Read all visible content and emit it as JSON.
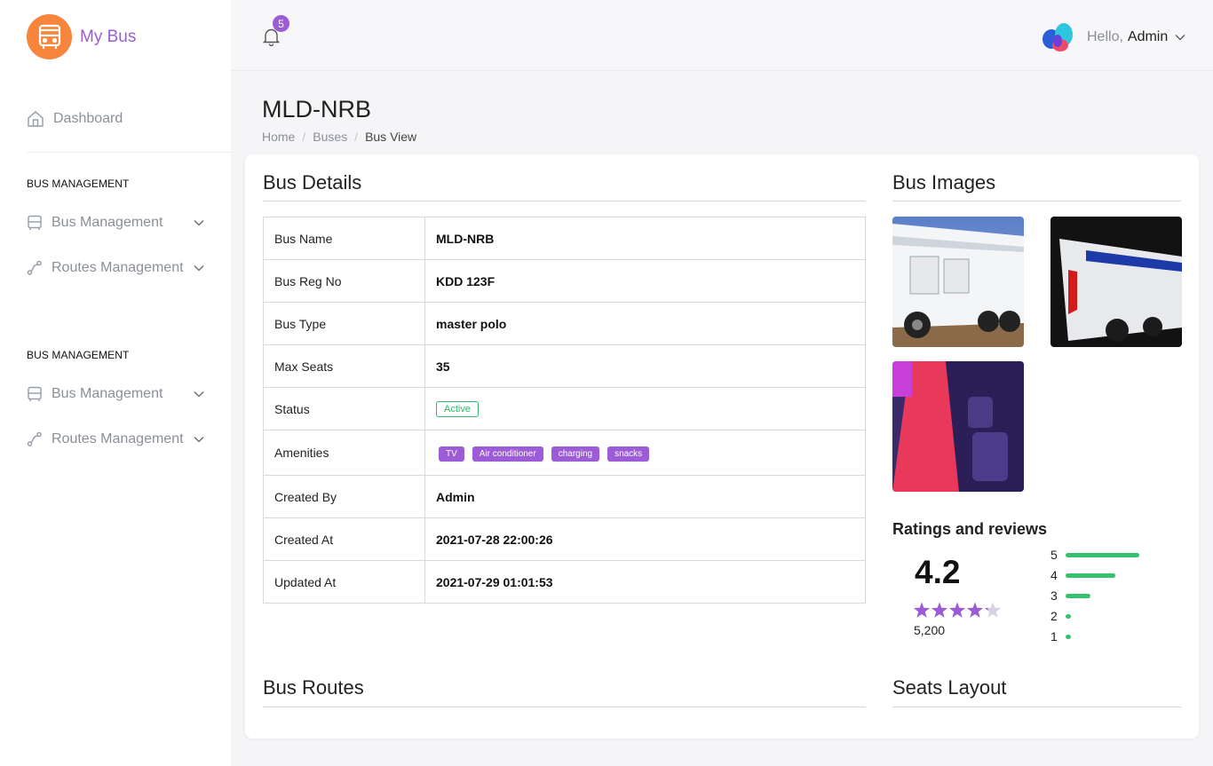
{
  "brand": {
    "name": "My Bus",
    "accent": "#9b5cd6",
    "logo_color": "#f7853b"
  },
  "sidebar": {
    "dashboard": "Dashboard",
    "sections": [
      {
        "heading": "BUS MANAGEMENT",
        "items": [
          {
            "label": "Bus Management",
            "icon": "bus-icon"
          },
          {
            "label": "Routes Management",
            "icon": "route-icon"
          }
        ]
      },
      {
        "heading": "BUS MANAGEMENT",
        "items": [
          {
            "label": "Bus Management",
            "icon": "bus-icon"
          },
          {
            "label": "Routes Management",
            "icon": "route-icon"
          }
        ]
      }
    ]
  },
  "topbar": {
    "notifications": "5",
    "greeting": "Hello,",
    "user": "Admin"
  },
  "page": {
    "title": "MLD-NRB",
    "breadcrumb": [
      "Home",
      "Buses",
      "Bus View"
    ]
  },
  "details": {
    "heading": "Bus Details",
    "rows": [
      {
        "key": "Bus Name",
        "value": "MLD-NRB"
      },
      {
        "key": "Bus Reg No",
        "value": "KDD 123F"
      },
      {
        "key": "Bus Type",
        "value": "master polo"
      },
      {
        "key": "Max Seats",
        "value": "35"
      },
      {
        "key": "Status",
        "value": "Active"
      },
      {
        "key": "Amenities",
        "tags": [
          "TV",
          "Air conditioner",
          "charging",
          "snacks"
        ]
      },
      {
        "key": "Created By",
        "value": "Admin"
      },
      {
        "key": "Created At",
        "value": "2021-07-28 22:00:26"
      },
      {
        "key": "Updated At",
        "value": "2021-07-29 01:01:53"
      }
    ]
  },
  "images": {
    "heading": "Bus Images",
    "items": [
      "bus-exterior-photo",
      "bus-night-photo",
      "bus-interior-photo"
    ]
  },
  "ratings": {
    "heading": "Ratings and reviews",
    "score": "4.2",
    "stars": 4.2,
    "count": "5,200",
    "distribution": [
      {
        "label": "5",
        "fraction": 0.85
      },
      {
        "label": "4",
        "fraction": 0.57
      },
      {
        "label": "3",
        "fraction": 0.29
      },
      {
        "label": "2",
        "fraction": 0.05
      },
      {
        "label": "1",
        "fraction": 0.05
      }
    ]
  },
  "routes": {
    "heading": "Bus Routes"
  },
  "seats": {
    "heading": "Seats Layout"
  }
}
